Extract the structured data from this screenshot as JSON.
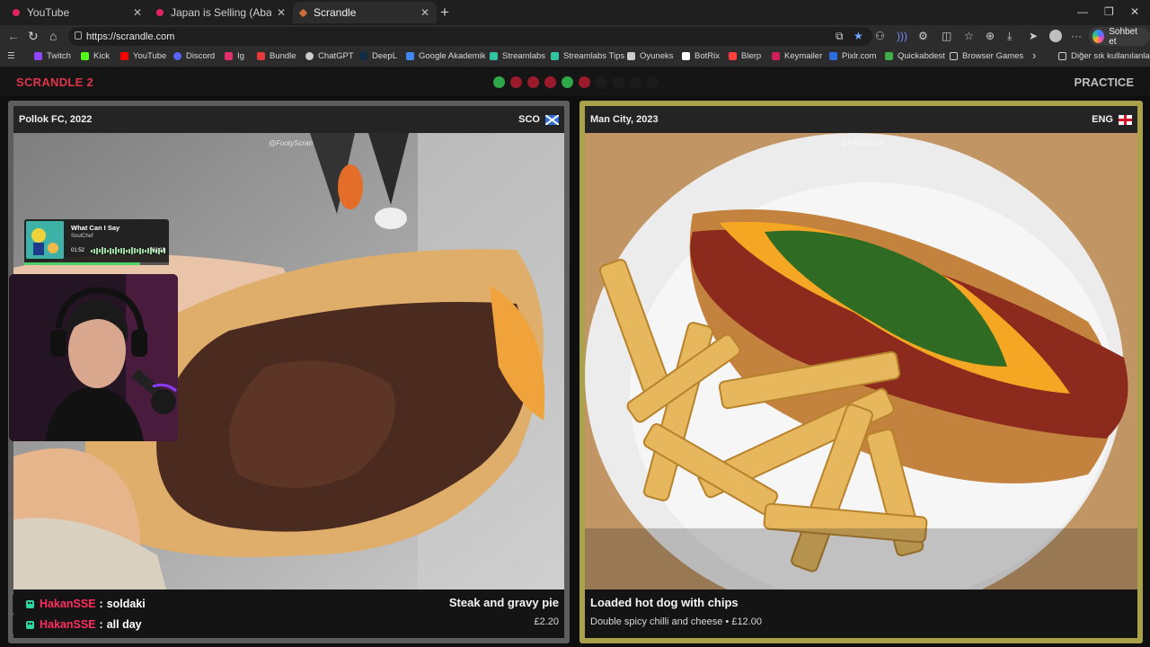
{
  "browser": {
    "tabs": [
      {
        "title": "YouTube",
        "active": false
      },
      {
        "title": "Japan is Selling (Abandoned) Hou",
        "active": false
      },
      {
        "title": "Scrandle",
        "active": true
      }
    ],
    "url": "https://scrandle.com",
    "copilot_label": "Sohbet et",
    "bookmarks": [
      {
        "label": "Twitch",
        "color": "#9146ff"
      },
      {
        "label": "Kick",
        "color": "#53fc18"
      },
      {
        "label": "YouTube",
        "color": "#ff0000"
      },
      {
        "label": "Discord",
        "color": "#5865f2"
      },
      {
        "label": "Ig",
        "color": "#e1306c"
      },
      {
        "label": "Bundle",
        "color": "#e03a3a"
      },
      {
        "label": "ChatGPT",
        "color": "#cccccc"
      },
      {
        "label": "DeepL",
        "color": "#0f2b46"
      },
      {
        "label": "Google Akademik",
        "color": "#4285f4"
      },
      {
        "label": "Streamlabs",
        "color": "#31c3a2"
      },
      {
        "label": "Streamlabs Tips",
        "color": "#31c3a2"
      },
      {
        "label": "Oyuneks",
        "color": "#cccccc"
      },
      {
        "label": "BotRix",
        "color": "#ffffff"
      },
      {
        "label": "Blerp",
        "color": "#ff3e3e"
      },
      {
        "label": "Keymailer",
        "color": "#d11f5c"
      },
      {
        "label": "Pixlr.com",
        "color": "#2d6cdf"
      },
      {
        "label": "Quickabdest",
        "color": "#3fae49"
      },
      {
        "label": "Browser Games",
        "color": "#cccccc"
      }
    ],
    "bookmarks_overflow": "›",
    "other_bookmarks": "Diğer sık kullanılanlar"
  },
  "game": {
    "logo": "SCRANDLE 2",
    "mode": "PRACTICE",
    "progress": [
      "correct",
      "wrong",
      "wrong",
      "wrong",
      "correct",
      "wrong",
      "pending",
      "pending",
      "pending",
      "pending"
    ],
    "colors": {
      "correct": "#2fa84a",
      "wrong": "#9b1b2c",
      "pending": "#1c1c1c"
    },
    "left": {
      "team": "Pollok FC, 2022",
      "country": "SCO",
      "watermark": "@FootyScran",
      "dish": "Steak and gravy pie",
      "price": "£2.20"
    },
    "right": {
      "team": "Man City, 2023",
      "country": "ENG",
      "watermark": "@FootyScran",
      "dish": "Loaded hot dog with chips",
      "price": "Double spicy chilli and cheese • £12.00"
    }
  },
  "stream": {
    "music": {
      "song": "What Can I Say",
      "artist": "SoulChef",
      "elapsed": "01:52",
      "total": "02:19",
      "progress": 0.8
    },
    "chat": [
      {
        "user": "HakanSSE",
        "message": "soldaki"
      },
      {
        "user": "HakanSSE",
        "message": "all day"
      }
    ]
  }
}
